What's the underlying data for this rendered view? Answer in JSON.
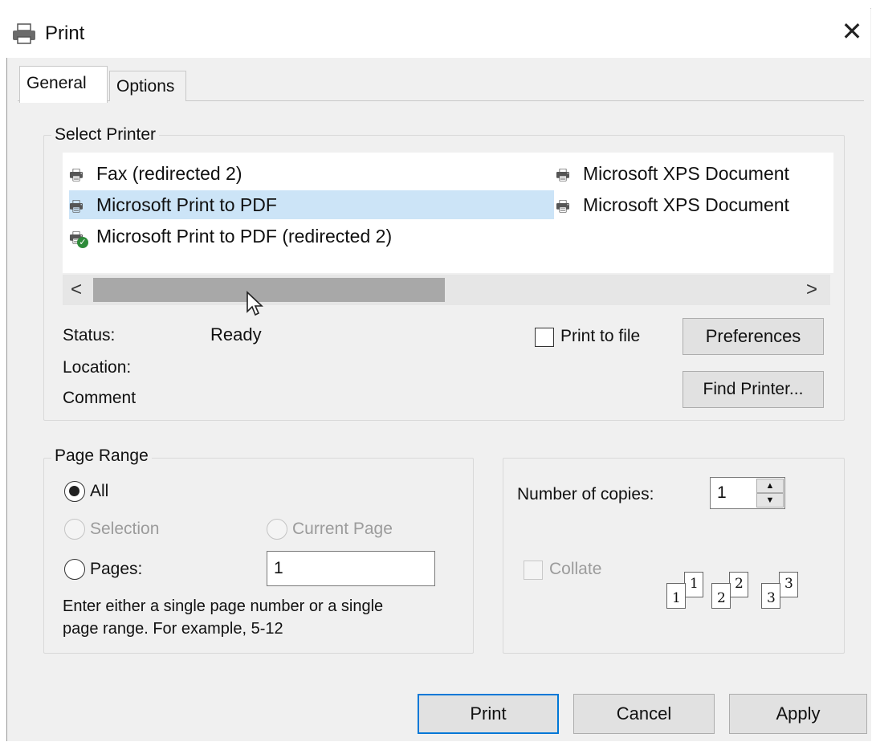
{
  "window": {
    "title": "Print",
    "close_glyph": "✕"
  },
  "tabs": [
    {
      "label": "General",
      "active": true
    },
    {
      "label": "Options",
      "active": false
    }
  ],
  "select_printer": {
    "group_title": "Select Printer",
    "printers": [
      {
        "name": "Fax (redirected 2)",
        "icon": "printer-icon"
      },
      {
        "name": "Microsoft Print to PDF",
        "icon": "printer-icon",
        "selected": true
      },
      {
        "name": "Microsoft Print to PDF (redirected 2)",
        "icon": "default-printer-icon"
      },
      {
        "name": "Microsoft XPS Document",
        "icon": "printer-icon"
      },
      {
        "name": "Microsoft XPS Document",
        "icon": "printer-icon"
      }
    ],
    "scroll_left": "<",
    "scroll_right": ">",
    "status_label": "Status:",
    "status_value": "Ready",
    "location_label": "Location:",
    "comment_label": "Comment",
    "print_to_file_label": "Print to file",
    "preferences_label": "Preferences",
    "find_printer_label": "Find Printer..."
  },
  "page_range": {
    "group_title": "Page Range",
    "all_label": "All",
    "selection_label": "Selection",
    "current_page_label": "Current Page",
    "pages_label": "Pages:",
    "pages_value": "1",
    "hint_line1": "Enter either a single page number or a single",
    "hint_line2": "page range.  For example, 5-12"
  },
  "copies": {
    "label": "Number of copies:",
    "value": "1",
    "collate_label": "Collate",
    "collate_pages": [
      "1",
      "2",
      "3"
    ]
  },
  "buttons": {
    "print": "Print",
    "cancel": "Cancel",
    "apply": "Apply"
  },
  "colors": {
    "selection": "#cce4f7",
    "dialog_bg": "#f0f0f0",
    "default_check": "#2e8b3a"
  }
}
